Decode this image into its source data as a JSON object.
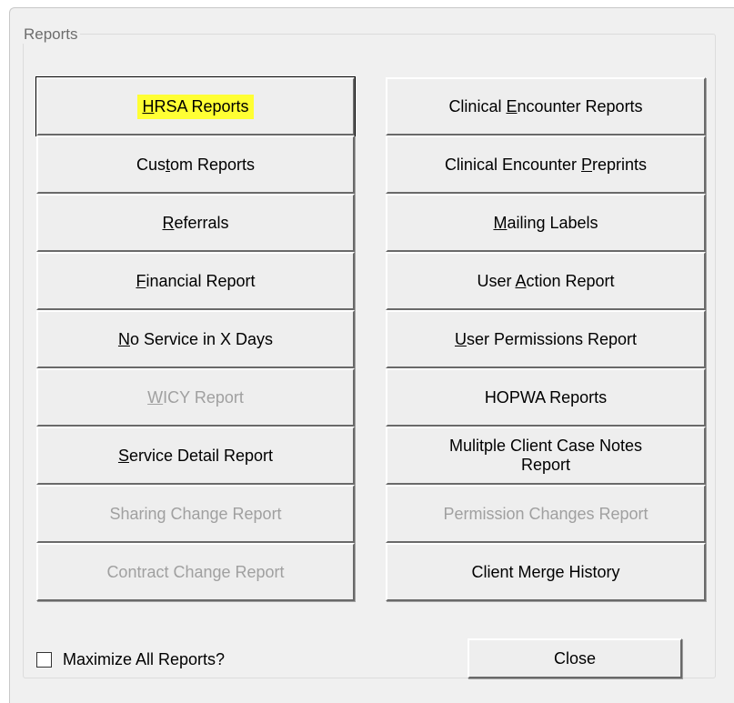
{
  "group_title": "Reports",
  "buttons": {
    "hrsa": {
      "pre": "",
      "ul": "H",
      "post": "RSA Reports"
    },
    "custom": {
      "pre": "Cus",
      "ul": "t",
      "post": "om Reports"
    },
    "referrals": {
      "pre": "",
      "ul": "R",
      "post": "eferrals"
    },
    "financial": {
      "pre": "",
      "ul": "F",
      "post": "inancial Report"
    },
    "noservice": {
      "pre": "",
      "ul": "N",
      "post": "o Service in X Days"
    },
    "wicy": {
      "pre": "",
      "ul": "W",
      "post": "ICY Report"
    },
    "servicedetail": {
      "pre": "",
      "ul": "S",
      "post": "ervice Detail Report"
    },
    "sharing": {
      "label": "Sharing Change Report"
    },
    "contract": {
      "label": "Contract Change Report"
    },
    "clinicalencounter": {
      "pre": "Clinical ",
      "ul": "E",
      "post": "ncounter Reports"
    },
    "preprints": {
      "pre": "Clinical Encounter ",
      "ul": "P",
      "post": "reprints"
    },
    "mailing": {
      "pre": "",
      "ul": "M",
      "post": "ailing Labels"
    },
    "useraction": {
      "pre": "User ",
      "ul": "A",
      "post": "ction Report"
    },
    "userperm": {
      "pre": "",
      "ul": "U",
      "post": "ser Permissions Report"
    },
    "hopwa": {
      "label": "HOPWA Reports"
    },
    "casenotes": {
      "line1": "Mulitple Client Case Notes",
      "line2": "Report"
    },
    "permchanges": {
      "label": "Permission Changes Report"
    },
    "merge": {
      "label": "Client Merge History"
    }
  },
  "maximize_label": "Maximize All Reports?",
  "maximize_checked": false,
  "close_label": "Close",
  "colors": {
    "highlight": "#ffff33",
    "disabled_text": "#a0a0a0",
    "face": "#eeeeee"
  }
}
